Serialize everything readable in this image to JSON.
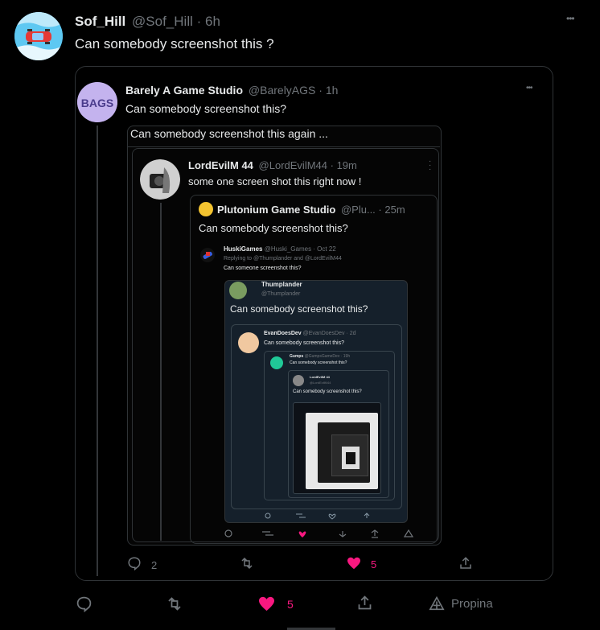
{
  "main": {
    "name": "Sof_Hill",
    "handle": "@Sof_Hill",
    "sep": "·",
    "time": "6h",
    "text": "Can somebody screenshot this ?",
    "more": "•••",
    "like_count": "5",
    "tip_label": "Propina"
  },
  "quote1": {
    "name": "Barely A Game Studio",
    "handle": "@BarelyAGS",
    "time": "· 1h",
    "text": "Can somebody screenshot this?",
    "avatar_text": "BAGS",
    "more": "•••",
    "reply_count": "2",
    "like_count": "5"
  },
  "quote2": {
    "text": "Can somebody screenshot this again ..."
  },
  "quote3": {
    "name": "LordEvilM 44",
    "handle": "@LordEvilM44",
    "time": "· 19m",
    "text": "some one screen shot this right now !"
  },
  "quote4": {
    "name": "Plutonium Game Studio",
    "handle": "@Plu...",
    "time": "· 25m",
    "text": "Can somebody screenshot this?"
  },
  "quote5": {
    "name": "HuskiGames",
    "handle": "@Huski_Games · Oct 22",
    "replying": "Replying to @Thumplander and @LordEvilM44",
    "text": "Can someone screenshot this?"
  },
  "quote6": {
    "name": "Thumplander",
    "handle": "@Thumplander",
    "text": "Can somebody screenshot this?"
  },
  "quote7": {
    "name": "EvanDoesDev",
    "handle": "@EvanDoesDev · 2d",
    "text": "Can somebody screenshot this?"
  },
  "quote8": {
    "name": "Gumps",
    "handle": "@GumpsGameDev · 19h",
    "text": "Can somebody screenshot this?"
  },
  "quote9": {
    "name": "LordEvilM 44",
    "handle": "@LordEvilM44",
    "text": "Can somebody screenshot this?"
  },
  "colors": {
    "background": "#000000",
    "border": "#2f3336",
    "muted": "#71767b",
    "like": "#f91880",
    "text": "#e7e9ea"
  }
}
